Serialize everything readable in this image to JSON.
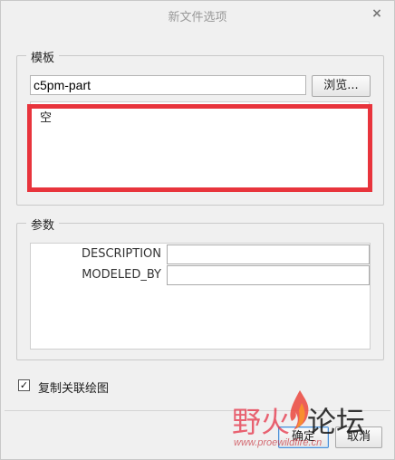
{
  "window": {
    "title": "新文件选项",
    "close_icon": "×"
  },
  "template_group": {
    "title": "模板",
    "input_value": "c5pm-part",
    "browse_label": "浏览...",
    "list_items": [
      "空"
    ]
  },
  "params_group": {
    "title": "参数",
    "rows": [
      {
        "label": "DESCRIPTION",
        "value": ""
      },
      {
        "label": "MODELED_BY",
        "value": ""
      }
    ]
  },
  "copy_drawing": {
    "label": "复制关联绘图",
    "checked": true,
    "check_mark": "✓"
  },
  "footer": {
    "ok_label": "确定",
    "cancel_label": "取消"
  },
  "watermark": {
    "text_left": "野火",
    "text_right": "论坛",
    "url": "www.proewildfire.cn"
  },
  "colors": {
    "highlight": "#e8343c",
    "ok_border": "#4a8fd6"
  }
}
